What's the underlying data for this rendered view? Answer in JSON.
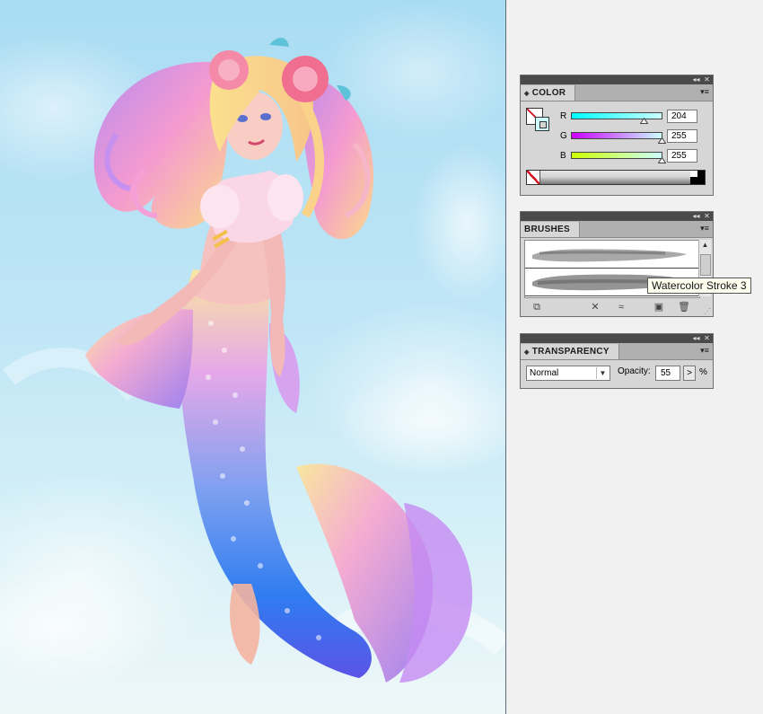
{
  "artwork": {
    "description_icon": "mermaid-illustration"
  },
  "color_panel": {
    "title": "COLOR",
    "rows": [
      {
        "label": "R",
        "value": "204",
        "fraction": 0.8,
        "gradient": "linear-gradient(to right,#00ffff,#ccffff)"
      },
      {
        "label": "G",
        "value": "255",
        "fraction": 1.0,
        "gradient": "linear-gradient(to right,#cc00ff,#ccffff)"
      },
      {
        "label": "B",
        "value": "255",
        "fraction": 1.0,
        "gradient": "linear-gradient(to right,#ccff00,#ccffff)"
      }
    ],
    "stroke_color": "#ccffff"
  },
  "brushes_panel": {
    "title": "BRUSHES",
    "tooltip": "Watercolor Stroke 3"
  },
  "transparency_panel": {
    "title": "TRANSPARENCY",
    "blend_mode": "Normal",
    "opacity_label": "Opacity:",
    "opacity_value": "55",
    "opacity_button": ">",
    "percent": "%"
  },
  "icons": {
    "panel_collapse": "◂◂",
    "panel_close": "✕",
    "panel_menu": "▾≡"
  }
}
